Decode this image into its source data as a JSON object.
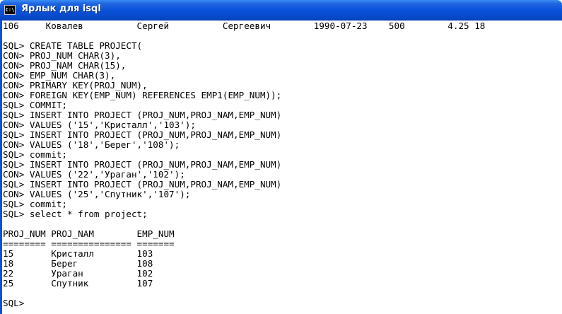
{
  "window": {
    "title": "Ярлык для isql",
    "icon_text": "C:\\"
  },
  "console_lines": [
    "106     Ковалев          Сергей          Сергеевич        1990-07-23    500        4.25 18",
    "",
    "SQL> CREATE TABLE PROJECT(",
    "CON> PROJ_NUM CHAR(3),",
    "CON> PROJ_NAM CHAR(15),",
    "CON> EMP_NUM CHAR(3),",
    "CON> PRIMARY KEY(PROJ_NUM),",
    "CON> FOREIGN KEY(EMP_NUM) REFERENCES EMP1(EMP_NUM));",
    "SQL> COMMIT;",
    "SQL> INSERT INTO PROJECT (PROJ_NUM,PROJ_NAM,EMP_NUM)",
    "CON> VALUES ('15','Кристалл','103');",
    "SQL> INSERT INTO PROJECT (PROJ_NUM,PROJ_NAM,EMP_NUM)",
    "CON> VALUES ('18','Берег','108');",
    "SQL> commit;",
    "SQL> INSERT INTO PROJECT (PROJ_NUM,PROJ_NAM,EMP_NUM)",
    "CON> VALUES ('22','Ураган','102');",
    "SQL> INSERT INTO PROJECT (PROJ_NUM,PROJ_NAM,EMP_NUM)",
    "CON> VALUES ('25','Спутник','107');",
    "SQL> commit;",
    "SQL> select * from project;",
    "",
    "PROJ_NUM PROJ_NAM        EMP_NUM",
    "======== =============== =======",
    "15       Кристалл        103",
    "18       Берег           108",
    "22       Ураган          102",
    "25       Спутник         107",
    "",
    "SQL>"
  ]
}
